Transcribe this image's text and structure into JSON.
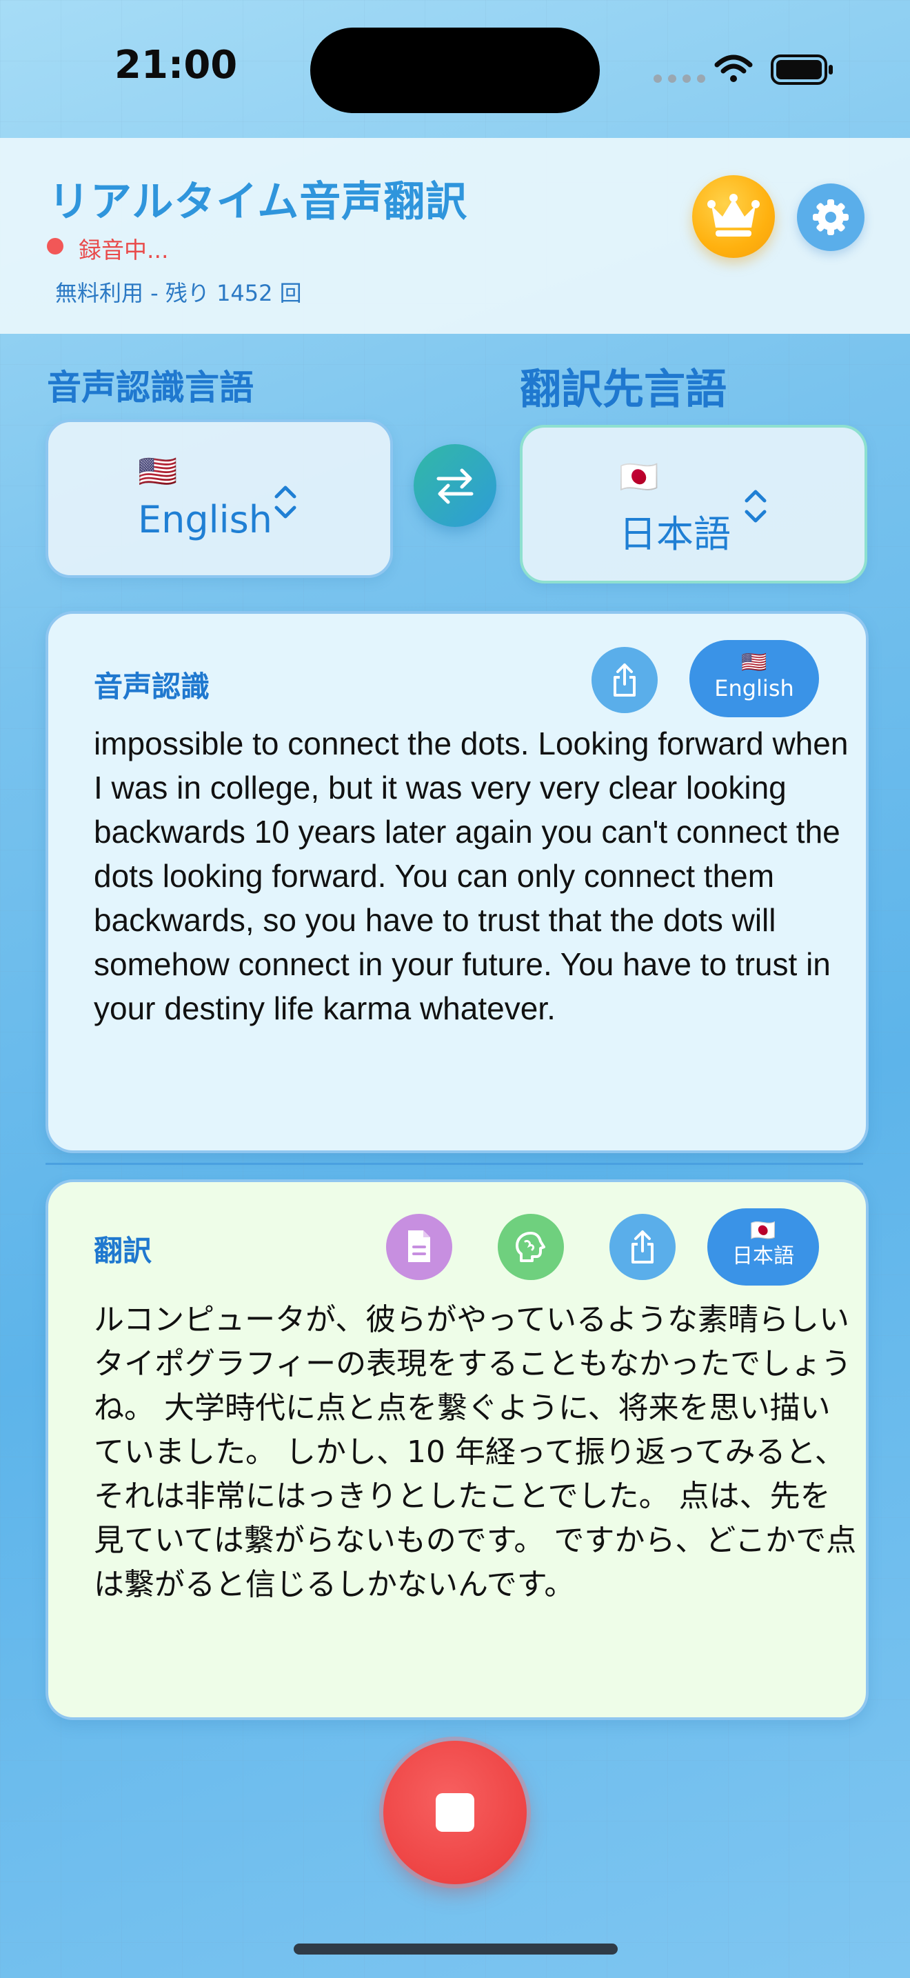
{
  "status_bar": {
    "time": "21:00"
  },
  "header": {
    "title": "リアルタイム音声翻訳",
    "recording_status": "録音中...",
    "usage": "無料利用 - 残り 1452 回"
  },
  "languages": {
    "source_label": "音声認識言語",
    "target_label": "翻訳先言語",
    "source": {
      "flag": "🇺🇸",
      "name": "English"
    },
    "target": {
      "flag": "🇯🇵",
      "name": "日本語"
    }
  },
  "speech_panel": {
    "title": "音声認識",
    "chip_flag": "🇺🇸",
    "chip_label": "English",
    "text": "wonderful typography that they do. Of course it was impossible to connect the dots. Looking forward when I was in college, but it was very very clear looking backwards 10 years later again you can't connect the dots looking forward. You can only connect them backwards, so you have to trust that the dots will somehow connect in your future. You have to trust in your destiny life karma whatever."
  },
  "translation_panel": {
    "title": "翻訳",
    "chip_flag": "🇯🇵",
    "chip_label": "日本語",
    "text": "の授業に立ち寄ることはなかったでしょうし、パーソナルコンピュータが、彼らがやっているような素晴らしいタイポグラフィーの表現をすることもなかったでしょうね。 大学時代に点と点を繋ぐように、将来を思い描いていました。 しかし、10 年経って振り返ってみると、それは非常にはっきりとしたことでした。 点は、先を見ていては繋がらないものです。 ですから、どこかで点は繋がると信じるしかないんです。"
  },
  "icons": {
    "crown": "crown-icon",
    "settings": "gear-icon",
    "swap": "swap-arrows-icon",
    "share": "share-icon",
    "document": "document-icon",
    "ai": "brain-icon",
    "stop": "stop-icon"
  },
  "colors": {
    "accent": "#2f95dc",
    "recording": "#ee4444",
    "crown": "#ffb10f",
    "speech_panel_bg": "#e3f5fd",
    "translation_panel_bg": "#eefde8"
  }
}
